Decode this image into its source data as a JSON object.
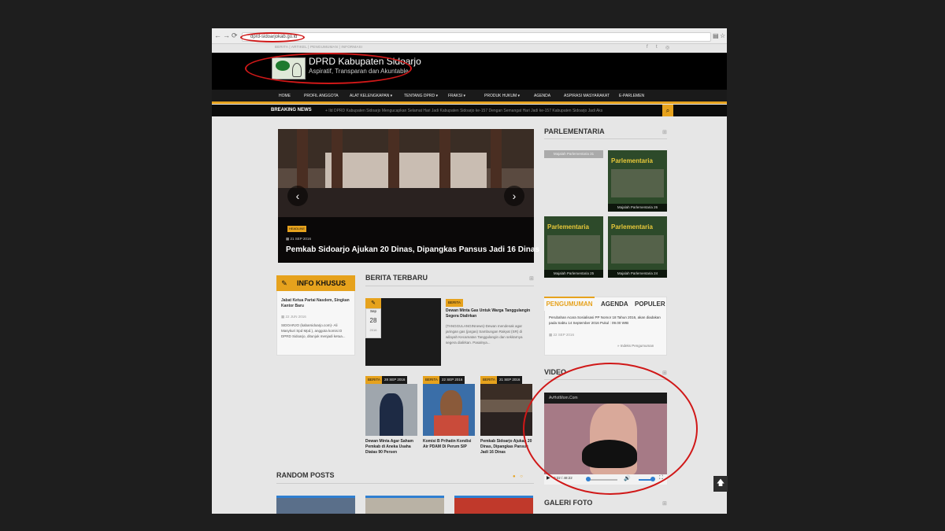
{
  "browser": {
    "url": "dprd-sidoarjokab.go.id",
    "back_glyph": "←",
    "forward_glyph": "→",
    "reload_glyph": "⟳",
    "bookmark_glyph": "☆",
    "page_glyph": "▤"
  },
  "topbar": {
    "links": "BERITA  |  ARTIKEL  |  PENGUMUMAN  |  INFORMASI",
    "social_icons": [
      "facebook-icon",
      "twitter-icon",
      "instagram-icon"
    ],
    "social_glyphs": [
      "f",
      "t",
      "◎"
    ]
  },
  "header": {
    "title": "DPRD Kabupaten Sidoarjo",
    "tagline": "Aspiratif, Transparan dan Akuntable"
  },
  "menu": {
    "items": [
      "HOME",
      "PROFIL ANGGOTA",
      "ALAT KELENGKAPAN ▾",
      "TENTANG DPRD ▾",
      "FRAKSI ▾",
      "PRODUK HUKUM ▾",
      "AGENDA",
      "ASPIRASI MASYARAKAT",
      "E-PARLEMEN"
    ]
  },
  "breaking": {
    "label": "BREAKING NEWS",
    "text": "+ Ild DPRD Kabupaten Sidoarjo Mengucapkan Selamat Hari Jadi Kabupaten Sidoarjo ke-157 Dengan Semangat Hari Jadi ke-157 Kabupaten Sidoarjo Jadi Aks",
    "search_glyph": "⌕"
  },
  "slider": {
    "tag": "HEADLINE",
    "date": "▦ 21 SEP 2016",
    "title": "Pemkab Sidoarjo Ajukan 20 Dinas, Dipangkas Pansus Jadi 16 Dinas",
    "prev_glyph": "‹",
    "next_glyph": "›"
  },
  "parlementaria": {
    "heading": "PARLEMENTARIA",
    "heading_icon": "⊞",
    "empty_caption": "Majalah Parlementaria 31",
    "magazines": [
      {
        "title": "Parlementaria",
        "caption": "Majalah Parlementaria 26"
      },
      {
        "title": "Parlementaria",
        "caption": "Majalah Parlementaria 25"
      },
      {
        "title": "Parlementaria",
        "caption": "Majalah Parlementaria 24"
      }
    ]
  },
  "info_khusus": {
    "label": "INFO KHUSUS",
    "pencil": "✎",
    "title": "Jabat Ketua Partai Nasdem, Singkan Kantor Baru",
    "date": "▦ 22 JUN 2016",
    "body": "SIDOARJO (kabarsidoarjo.com)- Ali Masykuri Spd Mpd.), anggota komisi D DPRD Sidoarjo, ditunjuk menjadi ketua..."
  },
  "berita_terbaru": {
    "heading": "BERITA TERBARU",
    "heading_icon": "⊞",
    "pencil": "✎",
    "date_month": "Sep",
    "date_day": "28",
    "date_year": "2016",
    "main_tag": "BERITA",
    "main_title": "Dewan Minta Gas Untuk Warga Tanggulangin Segera Dialirkan",
    "main_body": "(TANGGULANGINnews)-Dewan mendesak agar jaringan gas (jargas) Sambungan Rakyat (SR) di wilayah Kecamatan Tanggulangin dan sekitarnya segera dialirkan. Pasalnya...",
    "thumbs": [
      {
        "tag": "BERITA",
        "date": "28 SEP 2016",
        "title": "Dewan Minta Agar Saham Pemkab di Aneka Usaha Diatas 90 Persen"
      },
      {
        "tag": "BERITA",
        "date": "22 SEP 2016",
        "title": "Komisi B Prihatin Kondisi Air PDAM Di Perum SIP"
      },
      {
        "tag": "BERITA",
        "date": "21 SEP 2016",
        "title": "Pemkab Sidoarjo Ajukan 20 Dinas, Dipangkas Pansus Jadi 16 Dinas"
      }
    ]
  },
  "tabs": {
    "labels": [
      "PENGUMUMAN",
      "AGENDA",
      "POPULER"
    ],
    "title": "Perubahan Acara Sosialisasi PP Nomor 18 Tahun 2016, akan diadakan pada Sabtu 14 September 2016 Pukul : 09.00 WIB",
    "date": "▦ 22 SEP 2016",
    "index_link": "» Indeks Pengumuman"
  },
  "video": {
    "heading": "VIDEO",
    "heading_icon": "⊞",
    "title": "AvHotMom.Com",
    "time": "0:22 / 48:22",
    "play_glyph": "▶",
    "volume_glyph": "🔊",
    "fullscreen_glyph": "⛶"
  },
  "random_posts": {
    "heading": "RANDOM POSTS",
    "dots": "● ○"
  },
  "galeri": {
    "heading": "GALERI FOTO",
    "heading_icon": "⊞"
  },
  "scroll_top_glyph": "🡅",
  "colors": {
    "accent": "#e6a21d",
    "annotation_red": "#d01818",
    "backdrop": "#1e1e1e"
  }
}
